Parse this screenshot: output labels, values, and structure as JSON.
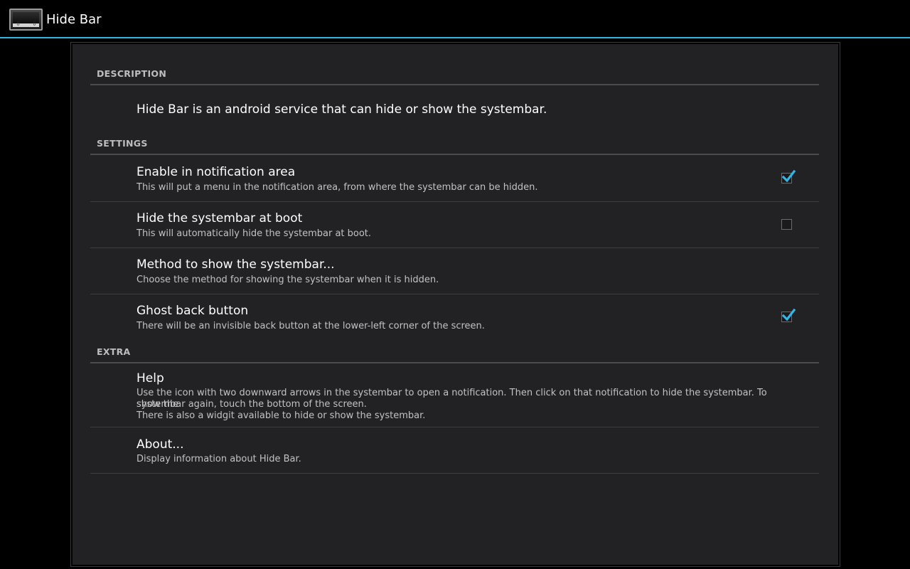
{
  "action_bar": {
    "title": "Hide Bar",
    "icon": "hide-bar-app-icon",
    "accent_color": "#33b5e5"
  },
  "categories": {
    "description": "DESCRIPTION",
    "settings": "SETTINGS",
    "extra": "EXTRA"
  },
  "description_text": "Hide Bar is an android service that can hide or show the systembar.",
  "settings": [
    {
      "title": "Enable in notification area",
      "summary": "This will put a menu in the notification area, from where the systembar can be hidden.",
      "checked": true
    },
    {
      "title": "Hide the systembar at boot",
      "summary": "This will automatically hide the systembar at boot.",
      "checked": false
    },
    {
      "title": "Method to show the systembar...",
      "summary": "Choose the method for showing the systembar when it is hidden."
    },
    {
      "title": "Ghost back button",
      "summary": "There will be an invisible back button at the lower-left corner of the screen.",
      "checked": true
    }
  ],
  "extra": [
    {
      "title": "Help",
      "summary_lines": [
        "Use the icon with two downward arrows in the systembar to open a notification. Then click on that notification to hide the systembar. To show the",
        "systembar again, touch the bottom of the screen.",
        "There is also a widgit available to hide or show the systembar."
      ]
    },
    {
      "title": "About...",
      "summary": "Display information about Hide Bar."
    }
  ]
}
